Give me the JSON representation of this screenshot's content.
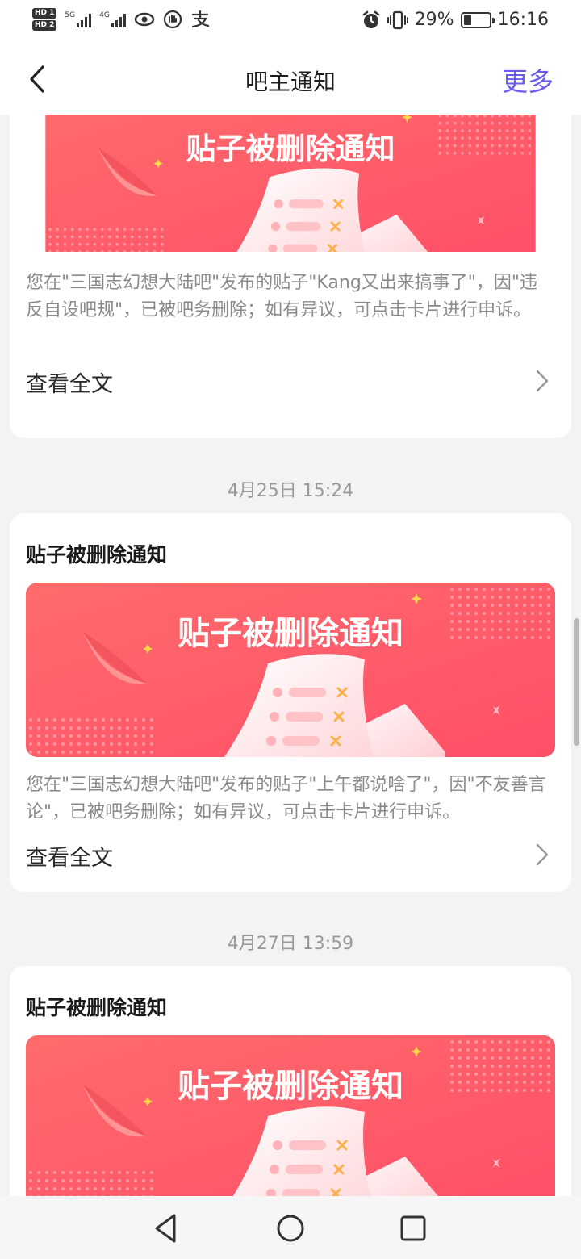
{
  "status_bar": {
    "hd1": "HD 1",
    "hd2": "HD 2",
    "sig1_label": "5G",
    "sig2_label": "4G",
    "battery_percent": "29%",
    "battery_level": 0.29,
    "time": "16:16",
    "icons": [
      "eye-icon",
      "hand-icon",
      "alipay-icon",
      "alarm-icon",
      "vibrate-icon"
    ]
  },
  "nav": {
    "title": "吧主通知",
    "more": "更多"
  },
  "banner": {
    "title": "贴子被删除通知",
    "colors": {
      "bg_start": "#ff6b6b",
      "bg_end": "#ff4f68",
      "accent": "#ffd84a"
    }
  },
  "cards": [
    {
      "title": "",
      "text": "您在\"三国志幻想大陆吧\"发布的贴子\"Kang又出来搞事了\"，因\"违反自设吧规\"，已被吧务删除；如有异议，可点击卡片进行申诉。",
      "link": "查看全文"
    },
    {
      "date": "4月25日 15:24",
      "title": "贴子被删除通知",
      "text": "您在\"三国志幻想大陆吧\"发布的贴子\"上午都说啥了\"，因\"不友善言论\"，已被吧务删除；如有异议，可点击卡片进行申诉。",
      "link": "查看全文"
    },
    {
      "date": "4月27日 13:59",
      "title": "贴子被删除通知"
    }
  ]
}
